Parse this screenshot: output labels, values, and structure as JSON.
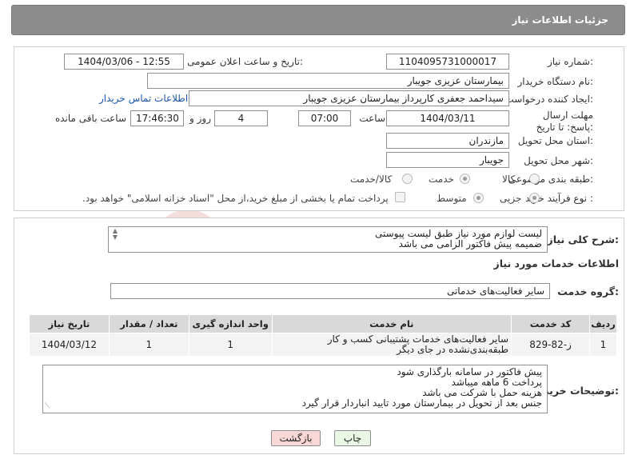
{
  "header": {
    "title": "جزئیات اطلاعات نیاز"
  },
  "fields": {
    "need_number_label": "شماره نیاز:",
    "need_number": "1104095731000017",
    "announce_datetime_label": "تاریخ و ساعت اعلان عمومی:",
    "announce_datetime": "1404/03/06 - 12:55",
    "buyer_org_label": "نام دستگاه خریدار:",
    "buyer_org": "بیمارستان عزیزی جویبار",
    "requester_label": "ایجاد کننده درخواست:",
    "requester": "سیداحمد جعفری کارپرداز بیمارستان عزیزی جویبار",
    "buyer_contact_link": "اطلاعات تماس خریدار",
    "deadline_label": "مهلت ارسال پاسخ: تا تاریخ:",
    "deadline_date": "1404/03/11",
    "time_label": "ساعت",
    "deadline_time": "07:00",
    "days_value": "4",
    "days_label": "روز و",
    "remaining_time": "17:46:30",
    "remaining_label": "ساعت باقی مانده",
    "province_label": "استان محل تحویل:",
    "province": "مازندران",
    "city_label": "شهر محل تحویل:",
    "city": "جویبار",
    "category_label": "طبقه بندی موضوعی:",
    "category_options": [
      "کالا",
      "خدمت",
      "کالا/خدمت"
    ],
    "category_selected": "خدمت",
    "process_label": "نوع فرآیند خرید :",
    "process_options": [
      "جزیی",
      "متوسط"
    ],
    "process_selected": "جزیی",
    "payment_text": "پرداخت تمام یا بخشی از مبلغ خرید،از محل \"اسناد خزانه اسلامی\" خواهد بود."
  },
  "description": {
    "label": "شرح کلی نیاز:",
    "lines": [
      "لیست لوازم مورد نیاز طبق لیست پیوستی",
      "ضمیمه پیش فاکتور الزامی می باشد"
    ]
  },
  "services": {
    "section_title": "اطلاعات خدمات مورد نیاز",
    "group_label": "گروه خدمت:",
    "group_value": "سایر فعالیت‌های خدماتی",
    "columns": [
      "ردیف",
      "کد خدمت",
      "نام خدمت",
      "واحد اندازه گیری",
      "تعداد / مقدار",
      "تاریخ نیاز"
    ],
    "rows": [
      {
        "row": "1",
        "code": "ز-82-829",
        "name": "سایر فعالیت‌های خدمات پشتیبانی کسب و کار طبقه‌بندی‌نشده در جای دیگر",
        "unit": "1",
        "qty": "1",
        "date": "1404/03/12"
      }
    ]
  },
  "buyer_notes": {
    "label": "توضیحات خریدار:",
    "lines": [
      "پیش فاکتور در سامانه بارگذاری شود",
      "پرداخت 6 ماهه میباشد",
      "هزینه حمل با شرکت می باشد",
      "جنس بعد از تحویل در بیمارستان مورد تایید انباردار قرار گیرد"
    ]
  },
  "buttons": {
    "print": "چاپ",
    "back": "بازگشت"
  },
  "watermark": {
    "text": "AriaTender.neT"
  },
  "colors": {
    "header_bg": "#8c8c8c",
    "link": "#1a55b0",
    "back_button_bg": "#f8d7d7",
    "print_button_bg": "#eaf7e4"
  }
}
